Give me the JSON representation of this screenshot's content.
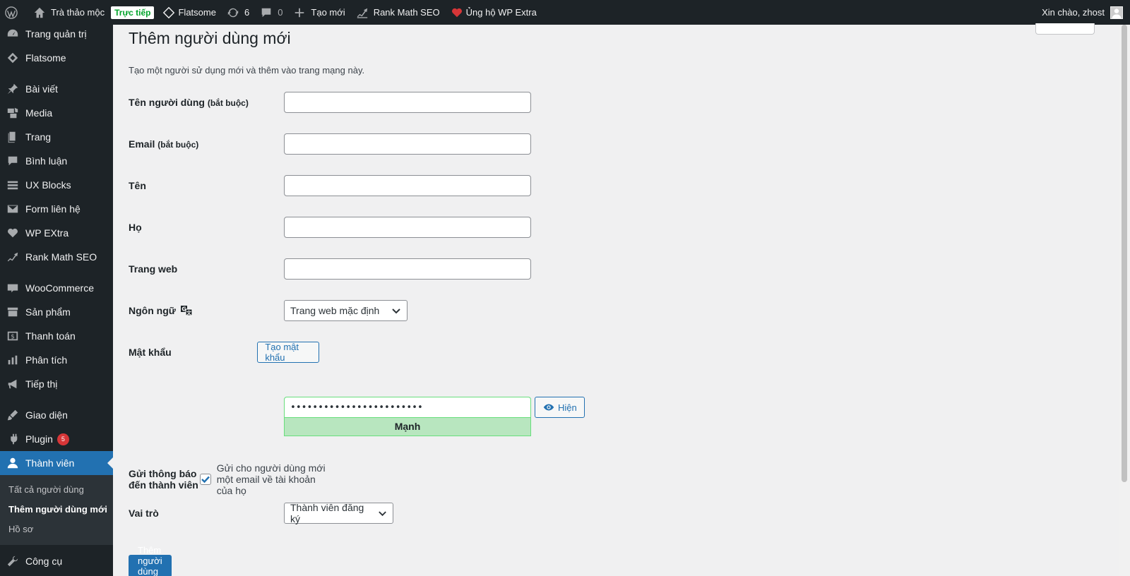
{
  "adminbar": {
    "site_name": "Trà thảo mộc",
    "live_label": "Trực tiếp",
    "theme_label": "Flatsome",
    "updates_count": "6",
    "comments_count": "0",
    "new_label": "Tạo mới",
    "rankmath_label": "Rank Math SEO",
    "support_label": "Ủng hộ WP Extra",
    "greeting": "Xin chào, zhost"
  },
  "sidebar": {
    "items": [
      {
        "label": "Trang quản trị",
        "icon": "dashboard-icon"
      },
      {
        "label": "Flatsome",
        "icon": "flatsome-icon"
      },
      {
        "label": "Bài viết",
        "icon": "pin-icon"
      },
      {
        "label": "Media",
        "icon": "media-icon"
      },
      {
        "label": "Trang",
        "icon": "page-icon"
      },
      {
        "label": "Bình luận",
        "icon": "comment-icon"
      },
      {
        "label": "UX Blocks",
        "icon": "blocks-icon"
      },
      {
        "label": "Form liên hệ",
        "icon": "mail-icon"
      },
      {
        "label": "WP EXtra",
        "icon": "heart-icon"
      },
      {
        "label": "Rank Math SEO",
        "icon": "chart-icon"
      },
      {
        "label": "WooCommerce",
        "icon": "woo-icon"
      },
      {
        "label": "Sản phẩm",
        "icon": "archive-icon"
      },
      {
        "label": "Thanh toán",
        "icon": "dollar-icon"
      },
      {
        "label": "Phân tích",
        "icon": "bar-chart-icon"
      },
      {
        "label": "Tiếp thị",
        "icon": "megaphone-icon"
      },
      {
        "label": "Giao diện",
        "icon": "brush-icon"
      },
      {
        "label": "Plugin",
        "icon": "plugin-icon"
      },
      {
        "label": "Thành viên",
        "icon": "user-icon"
      },
      {
        "label": "Công cụ",
        "icon": "wrench-icon"
      }
    ],
    "plugin_badge": "5",
    "submenu": [
      "Tất cả người dùng",
      "Thêm người dùng mới",
      "Hồ sơ"
    ]
  },
  "main": {
    "title": "Thêm người dùng mới",
    "description": "Tạo một người sử dụng mới và thêm vào trang mạng này.",
    "fields": {
      "username_label": "Tên người dùng",
      "required": "(bắt buộc)",
      "email_label": "Email",
      "firstname_label": "Tên",
      "lastname_label": "Họ",
      "website_label": "Trang web",
      "language_label": "Ngôn ngữ",
      "language_value": "Trang web mặc định",
      "password_label": "Mật khẩu",
      "generate_password": "Tạo mật khẩu",
      "password_value": "••••••••••••••••••••••••",
      "show_label": "Hiện",
      "strength_label": "Mạnh",
      "notify_label": "Gửi thông báo đến thành viên",
      "notify_text": "Gửi cho người dùng mới một email về tài khoản của họ",
      "role_label": "Vai trò",
      "role_value": "Thành viên đăng ký"
    },
    "submit_label": "Thêm người dùng mới"
  },
  "colors": {
    "adminbar_bg": "#1d2327",
    "accent": "#2271b1",
    "strength_bg": "#b8e6bf",
    "badge": "#d63638"
  }
}
